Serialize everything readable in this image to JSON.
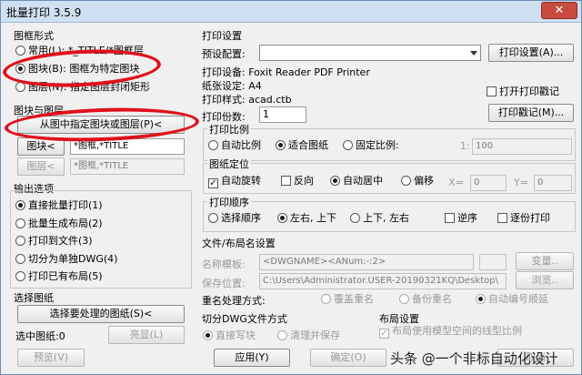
{
  "window": {
    "title": "批量打印 3.5.9",
    "close_label": "✕"
  },
  "frame_style": {
    "label": "图框形式",
    "options": [
      "常用(L): *_TITLE/*图框层",
      "图块(B): 图框为特定图块",
      "图层(N): 指定图层封闭矩形"
    ]
  },
  "block_layer": {
    "label": "图块与图层",
    "pick_button": "从图中指定图块或图层(P)<",
    "block_button": "图块<",
    "block_value": "*图框,*TITLE",
    "layer_button": "图层<",
    "layer_value": "*图框,*TITLE"
  },
  "output": {
    "label": "输出选项",
    "options": [
      "直接批量打印(1)",
      "批量生成布局(2)",
      "打印到文件(3)",
      "切分为单独DWG(4)",
      "打印已有布局(5)"
    ]
  },
  "select_drawing": {
    "label": "选择图纸",
    "button": "选择要处理的图纸(S)<",
    "count_label": "选中图纸:0",
    "highlight_button": "亮显(L)"
  },
  "print_settings": {
    "label": "打印设置",
    "preset_label": "预设配置:",
    "preset_button": "打印设置(A)...",
    "device": "打印设备: Foxit Reader PDF Printer",
    "paper": "纸张设定: A4",
    "style": "打印样式: acad.ctb",
    "copies_label": "打印份数:",
    "copies_value": "1",
    "stamp_check": "打开打印戳记",
    "stamp_button": "打印戳记(M)..."
  },
  "scale": {
    "label": "打印比例",
    "options": [
      "自动比例",
      "适合图纸",
      "固定比例:"
    ],
    "ratio_label": "1:",
    "ratio_value": "100"
  },
  "position": {
    "label": "图纸定位",
    "auto_rotate": "自动旋转",
    "reverse": "反向",
    "auto_center": "自动居中",
    "offset": "偏移",
    "x_label": "X=",
    "x_value": "0",
    "y_label": "Y=",
    "y_value": "0"
  },
  "order": {
    "label": "打印顺序",
    "options": [
      "选择顺序",
      "左右, 上下",
      "上下, 左右"
    ],
    "reverse": "逆序",
    "sheet_by_sheet": "逐份打印"
  },
  "file_layout": {
    "label": "文件/布局名设置",
    "name_template_label": "名称模板:",
    "name_template_value": "<DWGNAME><ANum:-:2>",
    "change_button": "变量..",
    "save_location_label": "保存位置:",
    "save_location_value": "C:\\Users\\Administrator.USER-20190321KQ\\Desktop\\",
    "browse_button": "浏览..",
    "rename_label": "重名处理方式:",
    "rename_options": [
      "覆盖重名",
      "备份重名",
      "自动编号顺延"
    ]
  },
  "split": {
    "label": "切分DWG文件方式",
    "options": [
      "直接写块",
      "清理并保存"
    ]
  },
  "layout_settings": {
    "label": "布局设置",
    "check": "布局使用模型空间的线型比例"
  },
  "footer": {
    "preview_button": "预览(V)",
    "apply_button": "应用(Y)",
    "ok_button": "确定(O)",
    "cancel_button": "取消"
  },
  "watermark": "头条 @一个非标自动化设计"
}
